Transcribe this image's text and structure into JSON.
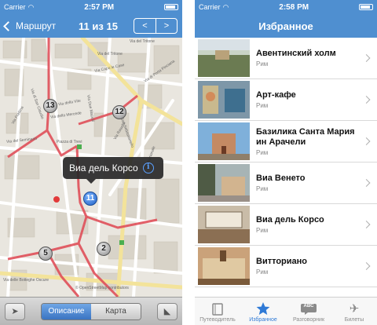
{
  "left_screen": {
    "status": {
      "carrier": "Carrier",
      "time": "2:57 PM"
    },
    "nav": {
      "back_label": "Маршрут",
      "counter": "11 из 15",
      "prev_label": "<",
      "next_label": ">"
    },
    "map": {
      "streets": [
        "Via del Tritone",
        "Via del Tritone",
        "Via Due Macelli",
        "Via Capo le Case",
        "Via della Mercede",
        "Via di San Claudio",
        "Via Rasella",
        "Via della Vite",
        "Via Frattina",
        "Via di Porta Pinciana",
        "Via di San Sebastianello",
        "Piazza di Trevi",
        "Via del Seminario",
        "Via delle Botteghe Oscure",
        "Via Nazionale"
      ],
      "pins": [
        "13",
        "12",
        "11",
        "5",
        "2"
      ],
      "callout": {
        "title": "Виа дель Корсо",
        "info_glyph": "i"
      },
      "attribution": "© OpenStreetMap contributors"
    },
    "toolbar": {
      "segment_left": "Описание",
      "segment_right": "Карта"
    }
  },
  "right_screen": {
    "status": {
      "carrier": "Carrier",
      "time": "2:58 PM"
    },
    "nav": {
      "title": "Избранное"
    },
    "items": [
      {
        "title": "Авентинский холм",
        "subtitle": "Рим"
      },
      {
        "title": "Арт-кафе",
        "subtitle": "Рим"
      },
      {
        "title": "Базилика Санта Мария ин Арачели",
        "subtitle": "Рим"
      },
      {
        "title": "Виа Венето",
        "subtitle": "Рим"
      },
      {
        "title": "Виа дель Корсо",
        "subtitle": "Рим"
      },
      {
        "title": "Витториано",
        "subtitle": "Рим"
      }
    ],
    "tabs": [
      {
        "label": "Путеводитель",
        "icon": "book-icon"
      },
      {
        "label": "Избранное",
        "icon": "star-icon"
      },
      {
        "label": "Разговорник",
        "icon": "speech-bubble-icon",
        "badge": "ABC"
      },
      {
        "label": "Билеты",
        "icon": "airplane-icon"
      }
    ]
  },
  "colors": {
    "nav_blue": "#4f8fd0",
    "route_red": "#e0505a",
    "tab_active": "#2f7ad6"
  }
}
